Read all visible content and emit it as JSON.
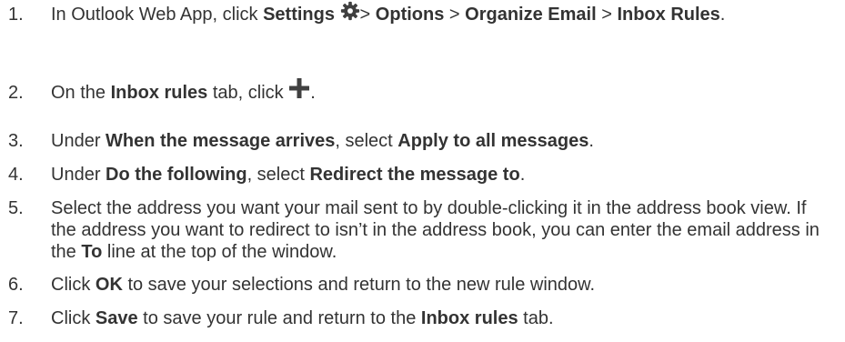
{
  "steps": [
    {
      "number": "1.",
      "parts": {
        "t1": "In Outlook Web App, click ",
        "b1": "Settings",
        "t2": "> ",
        "b2": "Options",
        "t3": " > ",
        "b3": "Organize Email",
        "t4": " > ",
        "b4": "Inbox Rules",
        "t5": "."
      },
      "icon": "gear-icon"
    },
    {
      "number": "2.",
      "parts": {
        "t1": "On the ",
        "b1": "Inbox rules",
        "t2": " tab, click ",
        "t3": "."
      },
      "icon": "plus-icon"
    },
    {
      "number": "3.",
      "parts": {
        "t1": "Under ",
        "b1": "When the message arrives",
        "t2": ", select ",
        "b2": "Apply to all messages",
        "t3": "."
      }
    },
    {
      "number": "4.",
      "parts": {
        "t1": "Under ",
        "b1": "Do the following",
        "t2": ", select ",
        "b2": "Redirect the message to",
        "t3": "."
      }
    },
    {
      "number": "5.",
      "parts": {
        "t1": "Select the address you want your mail sent to by double-clicking it in the address book view. If the address you want to redirect to isn’t in the address book, you can enter the email address in the ",
        "b1": "To",
        "t2": " line at the top of the window."
      }
    },
    {
      "number": "6.",
      "parts": {
        "t1": "Click ",
        "b1": "OK",
        "t2": " to save your selections and return to the new rule window."
      }
    },
    {
      "number": "7.",
      "parts": {
        "t1": "Click ",
        "b1": "Save",
        "t2": " to save your rule and return to the ",
        "b2": "Inbox rules",
        "t3": " tab."
      }
    }
  ],
  "colors": {
    "text": "#333333",
    "background": "#ffffff",
    "icon": "#404040"
  }
}
